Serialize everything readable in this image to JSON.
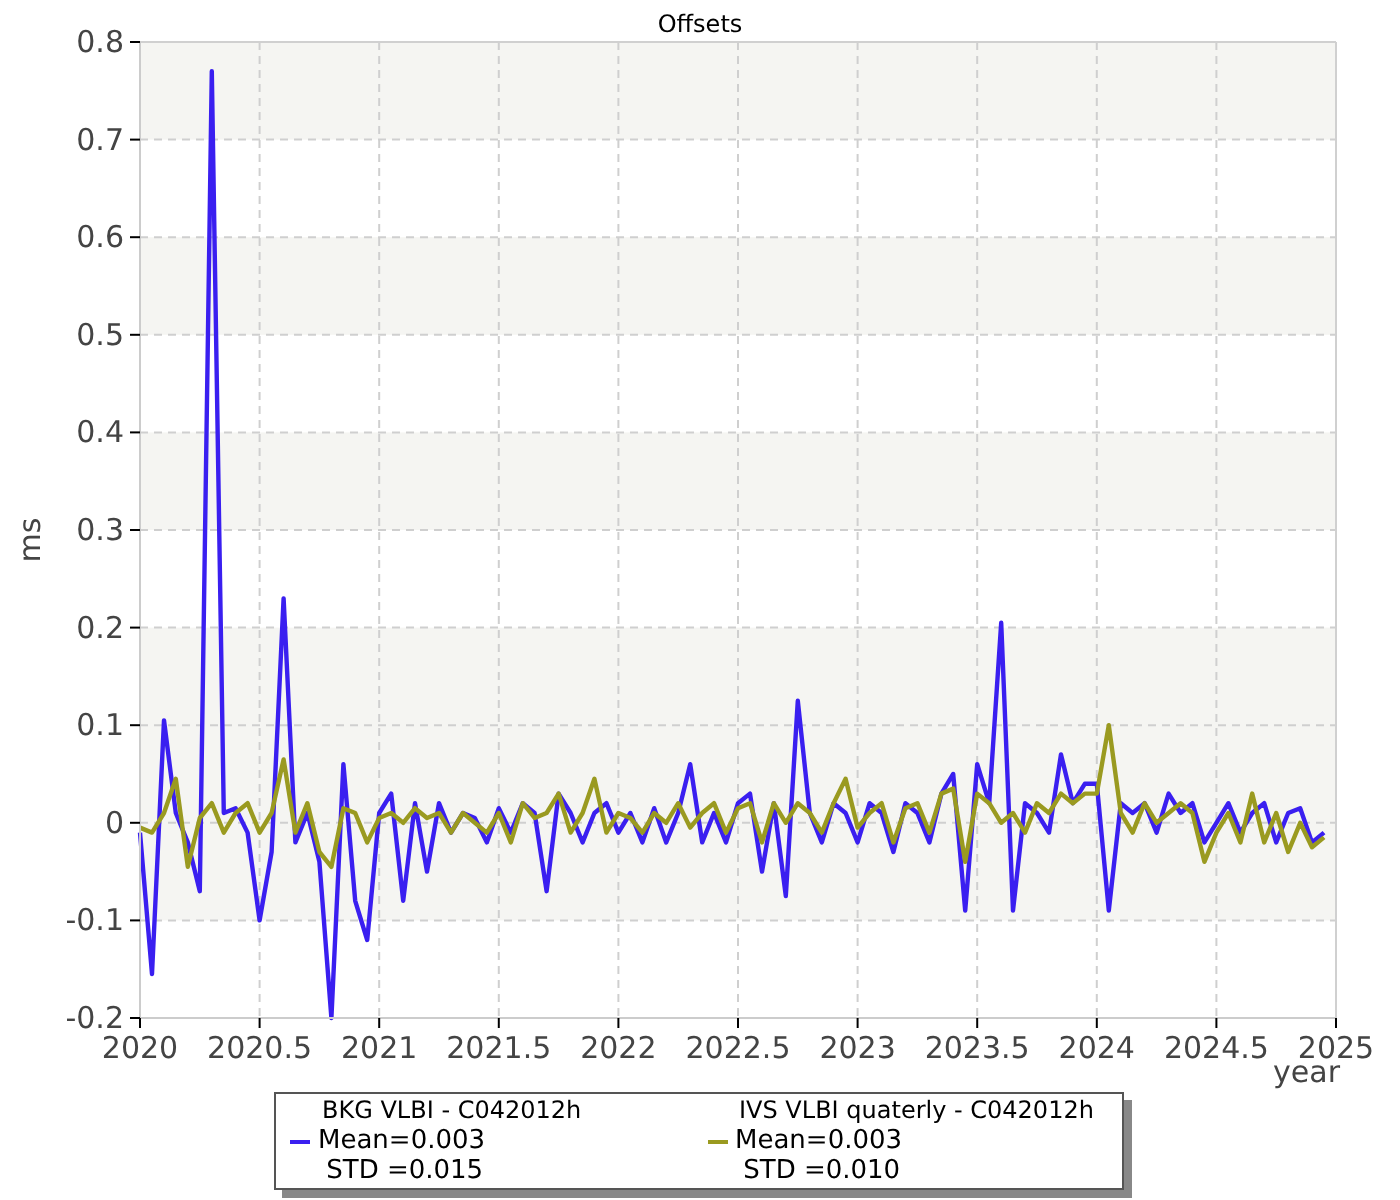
{
  "chart_data": {
    "type": "line",
    "title": "Offsets",
    "xlabel": "year",
    "ylabel": "ms",
    "x": [
      2020,
      2020.05,
      2020.1,
      2020.15,
      2020.2,
      2020.25,
      2020.3,
      2020.35,
      2020.4,
      2020.45,
      2020.5,
      2020.55,
      2020.6,
      2020.65,
      2020.7,
      2020.75,
      2020.8,
      2020.85,
      2020.9,
      2020.95,
      2021,
      2021.05,
      2021.1,
      2021.15,
      2021.2,
      2021.25,
      2021.3,
      2021.35,
      2021.4,
      2021.45,
      2021.5,
      2021.55,
      2021.6,
      2021.65,
      2021.7,
      2021.75,
      2021.8,
      2021.85,
      2021.9,
      2021.95,
      2022,
      2022.05,
      2022.1,
      2022.15,
      2022.2,
      2022.25,
      2022.3,
      2022.35,
      2022.4,
      2022.45,
      2022.5,
      2022.55,
      2022.6,
      2022.65,
      2022.7,
      2022.75,
      2022.8,
      2022.85,
      2022.9,
      2022.95,
      2023,
      2023.05,
      2023.1,
      2023.15,
      2023.2,
      2023.25,
      2023.3,
      2023.35,
      2023.4,
      2023.45,
      2023.5,
      2023.55,
      2023.6,
      2023.65,
      2023.7,
      2023.75,
      2023.8,
      2023.85,
      2023.9,
      2023.95,
      2024,
      2024.05,
      2024.1,
      2024.15,
      2024.2,
      2024.25,
      2024.3,
      2024.35,
      2024.4,
      2024.45,
      2024.5,
      2024.55,
      2024.6,
      2024.65,
      2024.7,
      2024.75,
      2024.8,
      2024.85,
      2024.9,
      2024.95
    ],
    "series": [
      {
        "name": "BKG VLBI - C042012h",
        "color": "#3a1ff0",
        "values": [
          -0.01,
          -0.155,
          0.105,
          0.01,
          -0.02,
          -0.07,
          0.77,
          0.01,
          0.015,
          -0.01,
          -0.1,
          -0.03,
          0.23,
          -0.02,
          0.01,
          -0.04,
          -0.2,
          0.06,
          -0.08,
          -0.12,
          0.01,
          0.03,
          -0.08,
          0.02,
          -0.05,
          0.02,
          -0.01,
          0.01,
          0.005,
          -0.02,
          0.015,
          -0.01,
          0.02,
          0.01,
          -0.07,
          0.03,
          0.01,
          -0.02,
          0.01,
          0.02,
          -0.01,
          0.01,
          -0.02,
          0.015,
          -0.02,
          0.01,
          0.06,
          -0.02,
          0.01,
          -0.02,
          0.02,
          0.03,
          -0.05,
          0.02,
          -0.075,
          0.125,
          0.01,
          -0.02,
          0.02,
          0.01,
          -0.02,
          0.02,
          0.01,
          -0.03,
          0.02,
          0.01,
          -0.02,
          0.03,
          0.05,
          -0.09,
          0.06,
          0.02,
          0.205,
          -0.09,
          0.02,
          0.01,
          -0.01,
          0.07,
          0.02,
          0.04,
          0.04,
          -0.09,
          0.02,
          0.01,
          0.02,
          -0.01,
          0.03,
          0.01,
          0.02,
          -0.02,
          0,
          0.02,
          -0.01,
          0.01,
          0.02,
          -0.02,
          0.01,
          0.015,
          -0.02,
          -0.01
        ]
      },
      {
        "name": "IVS VLBI quaterly - C042012h",
        "color": "#9a9a20",
        "values": [
          -0.005,
          -0.01,
          0.01,
          0.045,
          -0.045,
          0.005,
          0.02,
          -0.01,
          0.01,
          0.02,
          -0.01,
          0.01,
          0.065,
          -0.01,
          0.02,
          -0.03,
          -0.045,
          0.015,
          0.01,
          -0.02,
          0.005,
          0.01,
          0,
          0.015,
          0.005,
          0.01,
          -0.01,
          0.01,
          0,
          -0.01,
          0.01,
          -0.02,
          0.02,
          0.005,
          0.01,
          0.03,
          -0.01,
          0.01,
          0.045,
          -0.01,
          0.01,
          0.005,
          -0.01,
          0.01,
          0,
          0.02,
          -0.005,
          0.01,
          0.02,
          -0.01,
          0.015,
          0.02,
          -0.02,
          0.02,
          0,
          0.02,
          0.01,
          -0.01,
          0.02,
          0.045,
          -0.005,
          0.01,
          0.02,
          -0.02,
          0.015,
          0.02,
          -0.01,
          0.03,
          0.035,
          -0.04,
          0.03,
          0.02,
          0,
          0.01,
          -0.01,
          0.02,
          0.01,
          0.03,
          0.02,
          0.03,
          0.03,
          0.1,
          0.01,
          -0.01,
          0.02,
          0,
          0.01,
          0.02,
          0.01,
          -0.04,
          -0.01,
          0.01,
          -0.02,
          0.03,
          -0.02,
          0.01,
          -0.03,
          0,
          -0.025,
          -0.015
        ]
      }
    ],
    "xlim": [
      2020,
      2025
    ],
    "ylim": [
      -0.2,
      0.8
    ],
    "xticks": [
      2020,
      2020.5,
      2021,
      2021.5,
      2022,
      2022.5,
      2023,
      2023.5,
      2024,
      2024.5,
      2025
    ],
    "yticks": [
      -0.2,
      -0.1,
      0,
      0.1,
      0.2,
      0.3,
      0.4,
      0.5,
      0.6,
      0.7,
      0.8
    ],
    "grid": true
  },
  "legend": [
    {
      "mean": "Mean=0.003",
      "std": " STD =0.015"
    },
    {
      "mean": "Mean=0.003",
      "std": " STD =0.010"
    }
  ]
}
